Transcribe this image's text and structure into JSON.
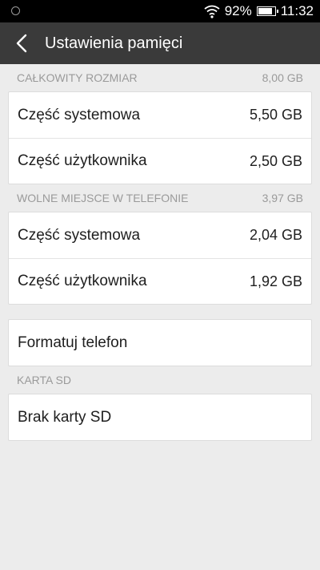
{
  "status_bar": {
    "battery_percent": "92%",
    "battery_level": 0.92,
    "time": "11:32",
    "icons": [
      "sync-circle-icon",
      "wifi-icon",
      "battery-icon"
    ]
  },
  "app_bar": {
    "title": "Ustawienia pamięci",
    "back_icon": "chevron-left-icon"
  },
  "total_size": {
    "header": "CAŁKOWITY ROZMIAR",
    "value": "8,00 GB",
    "rows": [
      {
        "label": "Część systemowa",
        "value": "5,50 GB"
      },
      {
        "label": "Część użytkownika",
        "value": "2,50 GB"
      }
    ]
  },
  "free_space": {
    "header": "WOLNE MIEJSCE W TELEFONIE",
    "value": "3,97 GB",
    "rows": [
      {
        "label": "Część systemowa",
        "value": "2,04 GB"
      },
      {
        "label": "Część użytkownika",
        "value": "1,92 GB"
      }
    ]
  },
  "format": {
    "label": "Formatuj telefon"
  },
  "sd_card": {
    "header": "KARTA SD",
    "label": "Brak karty SD"
  },
  "colors": {
    "status_bar": "#000000",
    "app_bar": "#3a3a3a",
    "background": "#ececec",
    "card": "#ffffff",
    "section_text": "#9a9a9a"
  }
}
